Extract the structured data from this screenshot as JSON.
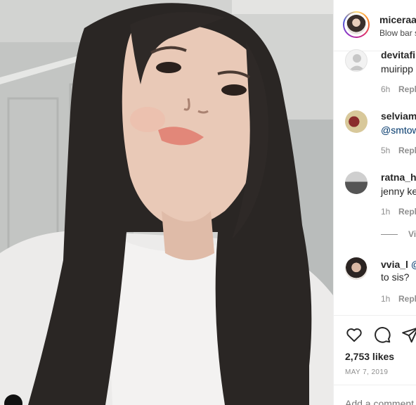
{
  "post": {
    "image_alt": "Portrait photo of a young woman with long dark wavy hair in a white ribbed top"
  },
  "header": {
    "username": "miceraa",
    "caption": "Blow bar s"
  },
  "comments": [
    {
      "user": "devitafir",
      "text": "muiripp",
      "mention": "",
      "time": "6h",
      "reply": "Reply"
    },
    {
      "user": "selviamu",
      "text": "",
      "mention": "@smtow",
      "time": "5h",
      "reply": "Reply"
    },
    {
      "user": "ratna_ha",
      "text": "jenny ke",
      "mention": "",
      "time": "1h",
      "reply": "Reply"
    },
    {
      "user": "vvia_l",
      "text": "to sis?",
      "mention": "@",
      "time": "1h",
      "reply": "Reply"
    }
  ],
  "view_replies": "Vi",
  "actions": {
    "like_icon": "heart-icon",
    "comment_icon": "speech-bubble-icon",
    "share_icon": "paper-plane-icon"
  },
  "likes": "2,753 likes",
  "date": "MAY 7, 2019",
  "add_comment_placeholder": "Add a comment..."
}
